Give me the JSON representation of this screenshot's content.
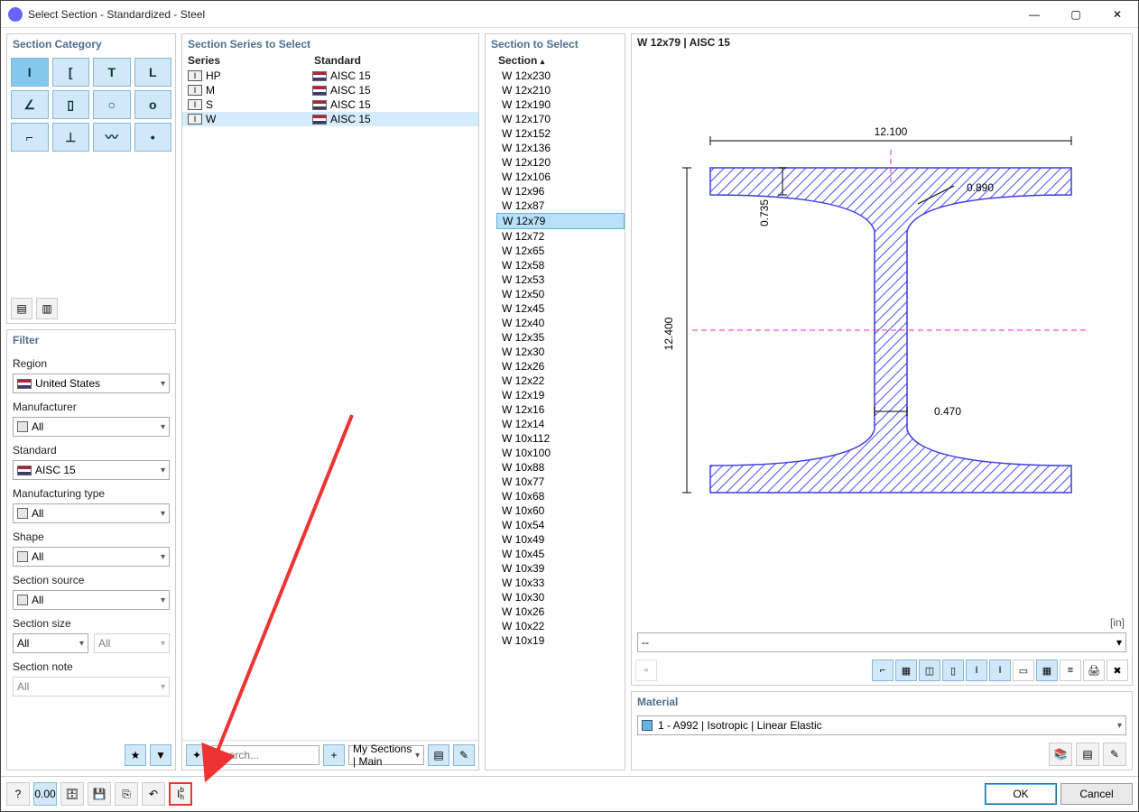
{
  "window": {
    "title": "Select Section - Standardized - Steel"
  },
  "category": {
    "title": "Section Category",
    "shapes_row1": [
      "I",
      "[",
      "T",
      "L"
    ],
    "shapes_row2": [
      "∠",
      "▯",
      "○",
      "o"
    ],
    "shapes_row3": [
      "⌐",
      "⊥",
      "〰",
      "•"
    ]
  },
  "filter": {
    "title": "Filter",
    "labels": {
      "region": "Region",
      "manufacturer": "Manufacturer",
      "standard": "Standard",
      "mtype": "Manufacturing type",
      "shape": "Shape",
      "source": "Section source",
      "size": "Section size",
      "note": "Section note"
    },
    "values": {
      "region": "United States",
      "manufacturer": "All",
      "standard": "AISC 15",
      "mtype": "All",
      "shape": "All",
      "source": "All",
      "size1": "All",
      "size2": "All",
      "note": "All"
    }
  },
  "series": {
    "title": "Section Series to Select",
    "header": {
      "series": "Series",
      "standard": "Standard"
    },
    "rows": [
      {
        "s": "HP",
        "std": "AISC 15",
        "sel": false
      },
      {
        "s": "M",
        "std": "AISC 15",
        "sel": false
      },
      {
        "s": "S",
        "std": "AISC 15",
        "sel": false
      },
      {
        "s": "W",
        "std": "AISC 15",
        "sel": true
      }
    ],
    "search_placeholder": "Search...",
    "mysections": "My Sections | Main"
  },
  "sections": {
    "title": "Section to Select",
    "header": "Section",
    "selected": "W 12x79",
    "items": [
      "W 12x230",
      "W 12x210",
      "W 12x190",
      "W 12x170",
      "W 12x152",
      "W 12x136",
      "W 12x120",
      "W 12x106",
      "W 12x96",
      "W 12x87",
      "W 12x79",
      "W 12x72",
      "W 12x65",
      "W 12x58",
      "W 12x53",
      "W 12x50",
      "W 12x45",
      "W 12x40",
      "W 12x35",
      "W 12x30",
      "W 12x26",
      "W 12x22",
      "W 12x19",
      "W 12x16",
      "W 12x14",
      "W 10x112",
      "W 10x100",
      "W 10x88",
      "W 10x77",
      "W 10x68",
      "W 10x60",
      "W 10x54",
      "W 10x49",
      "W 10x45",
      "W 10x39",
      "W 10x33",
      "W 10x30",
      "W 10x26",
      "W 10x22",
      "W 10x19"
    ]
  },
  "preview": {
    "title": "W 12x79 | AISC 15",
    "dims": {
      "bf": "12.100",
      "tf": "0.735",
      "tw": "0.470",
      "r": "0.890",
      "d": "12.400"
    },
    "unit": "[in]",
    "stress_sel": "--"
  },
  "material": {
    "title": "Material",
    "value": "1 - A992 | Isotropic | Linear Elastic"
  },
  "buttons": {
    "ok": "OK",
    "cancel": "Cancel"
  }
}
